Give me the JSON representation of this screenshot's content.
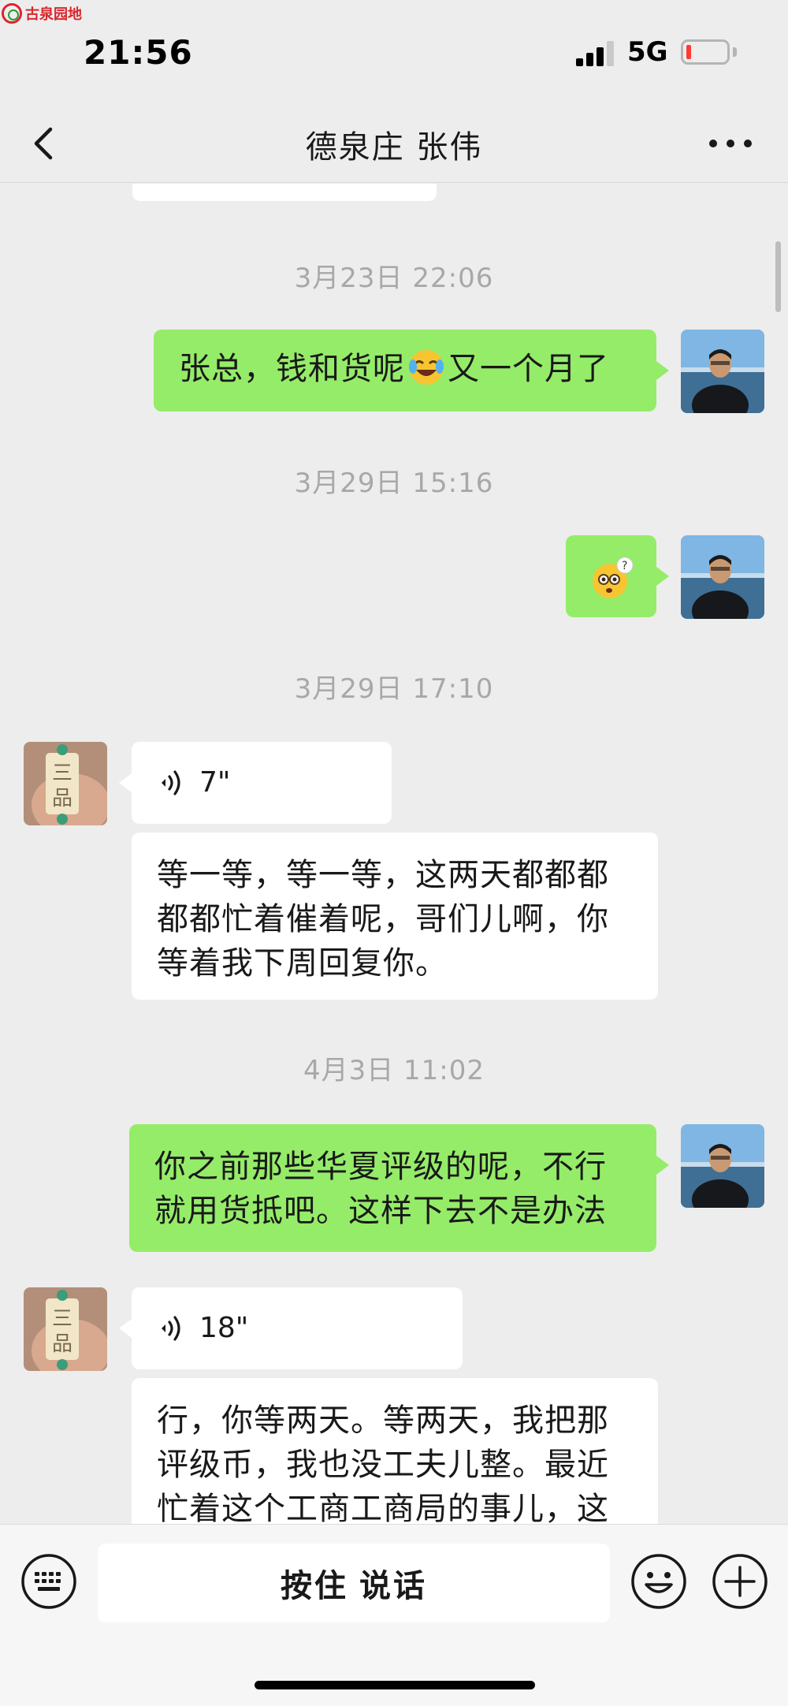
{
  "watermark": {
    "text": "古泉园地"
  },
  "status_bar": {
    "time": "21:56",
    "network": "5G",
    "battery_low": true
  },
  "nav": {
    "title": "德泉庄  张伟"
  },
  "messages": [
    {
      "type": "timestamp",
      "text": "3月23日 22:06"
    },
    {
      "type": "text",
      "sender": "me",
      "text_before": "张总，钱和货呢",
      "emoji": "crying-laughing-emoji",
      "text_after": "又一个月了"
    },
    {
      "type": "timestamp",
      "text": "3月29日 15:16"
    },
    {
      "type": "sticker",
      "sender": "me",
      "emoji": "confused-face-emoji"
    },
    {
      "type": "timestamp",
      "text": "3月29日 17:10"
    },
    {
      "type": "voice",
      "sender": "contact",
      "duration": "7\""
    },
    {
      "type": "text",
      "sender": "contact",
      "text": "等一等，等一等，这两天都都都都都忙着催着呢，哥们儿啊，你等着我下周回复你。"
    },
    {
      "type": "timestamp",
      "text": "4月3日 11:02"
    },
    {
      "type": "text",
      "sender": "me",
      "text": "你之前那些华夏评级的呢，不行就用货抵吧。这样下去不是办法"
    },
    {
      "type": "voice",
      "sender": "contact",
      "duration": "18\""
    },
    {
      "type": "text",
      "sender": "contact",
      "text": "行，你等两天。等两天，我把那评级币，我也没工夫儿整。最近忙着这个工商工商局的事儿，这"
    }
  ],
  "input_bar": {
    "hold_to_talk_label": "按住 说话"
  },
  "colors": {
    "background": "#ededed",
    "my_bubble": "#95ec69",
    "contact_bubble": "#ffffff",
    "timestamp_text": "#a8a8a8"
  }
}
